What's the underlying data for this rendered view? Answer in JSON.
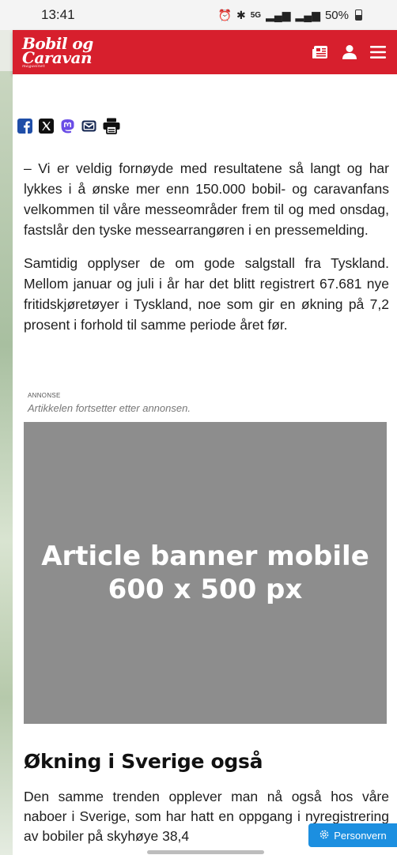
{
  "status_bar": {
    "time": "13:41",
    "battery": "50%",
    "network": "5G"
  },
  "header": {
    "logo_line1": "Bobil og",
    "logo_line2": "Caravan",
    "logo_line3": "magasinet",
    "brand_color": "#d71f2d",
    "icons": [
      "newspaper-icon",
      "user-icon",
      "menu-icon"
    ]
  },
  "share_icons": [
    "facebook-icon",
    "x-icon",
    "mastodon-icon",
    "email-icon",
    "print-icon"
  ],
  "article": {
    "p1": "– Vi er veldig fornøyde med resultatene så langt og har lykkes i å ønske mer enn 150.000 bobil- og caravanfans velkommen til våre messeområder frem til og med onsdag, fastslår den tyske messearrangøren i en pressemelding.",
    "p2": "Samtidig opplyser de om gode salgstall fra Tyskland. Mellom januar og juli i år har det blitt registrert 67.681 nye fritidskjøretøyer i Tyskland, noe som gir en økning på 7,2 prosent i forhold til samme periode året før."
  },
  "ad": {
    "label": "ANNONSE",
    "note": "Artikkelen fortsetter etter annonsen.",
    "banner_line1": "Article banner mobile",
    "banner_line2": "600 x 500 px"
  },
  "section": {
    "heading": "Økning i Sverige også",
    "p3": "Den samme trenden opplever man nå også hos våre naboer i Sverige, som har hatt en oppgang i nyregistrering av bobiler på skyhøye 38,4"
  },
  "privacy_button": "Personvern"
}
